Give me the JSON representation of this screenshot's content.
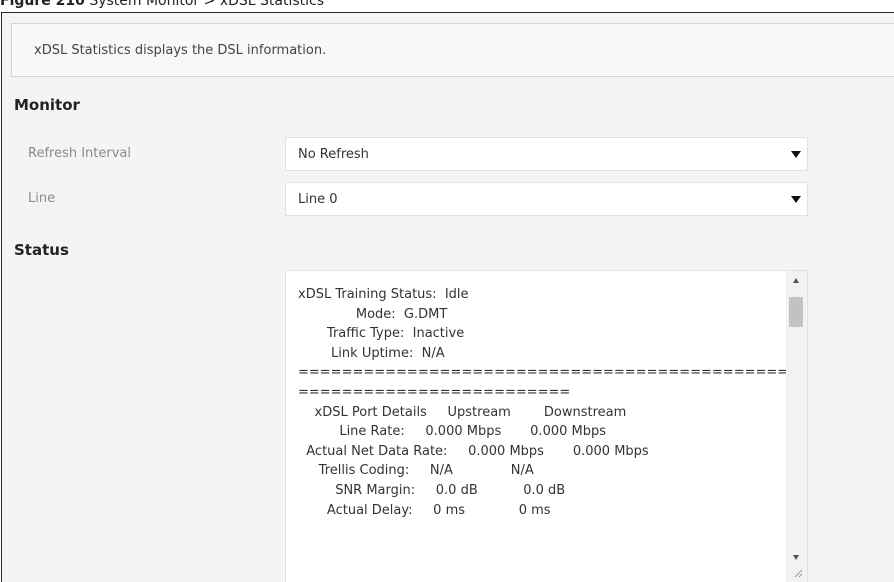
{
  "caption": {
    "prefix": "Figure 210",
    "text": "System Monitor > xDSL Statistics"
  },
  "description": "xDSL Statistics displays the DSL information.",
  "monitor": {
    "title": "Monitor",
    "refresh_label": "Refresh Interval",
    "refresh_value": "No Refresh",
    "line_label": "Line",
    "line_value": "Line 0"
  },
  "status": {
    "title": "Status",
    "text": "xDSL Training Status:  Idle\n              Mode:  G.DMT\n       Traffic Type:  Inactive\n        Link Uptime:  N/A\n====================================================\n=========================\n    xDSL Port Details     Upstream        Downstream\n          Line Rate:     0.000 Mbps       0.000 Mbps\n  Actual Net Data Rate:     0.000 Mbps       0.000 Mbps\n     Trellis Coding:     N/A              N/A\n         SNR Margin:     0.0 dB           0.0 dB\n       Actual Delay:     0 ms             0 ms"
  },
  "icons": {
    "dropdown": "dropdown-arrow-icon",
    "scroll_up": "scroll-up-icon",
    "scroll_down": "scroll-down-icon",
    "resize": "resize-grip-icon"
  }
}
